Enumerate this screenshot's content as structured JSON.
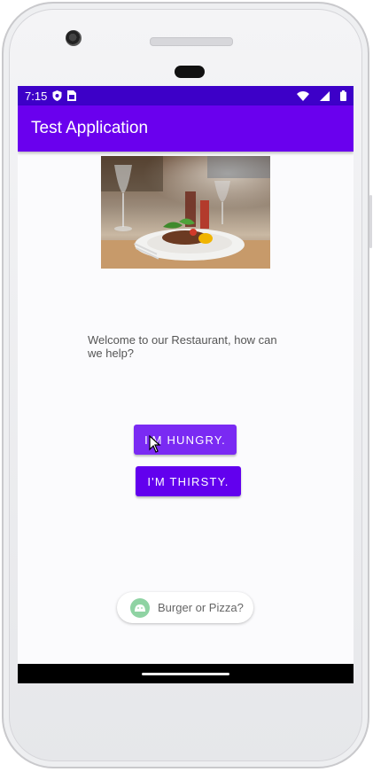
{
  "status_bar": {
    "time": "7:15",
    "left_icons": [
      "shield-icon",
      "sim-card-icon"
    ],
    "right_icons": [
      "wifi-icon",
      "cell-signal-icon",
      "battery-icon"
    ]
  },
  "app_bar": {
    "title": "Test Application"
  },
  "hero_image": {
    "subject": "restaurant-plate-image"
  },
  "welcome_text": "Welcome to our Restaurant, how can we help?",
  "buttons": {
    "hungry": "I'M HUNGRY.",
    "thirsty": "I'M THIRSTY."
  },
  "suggestion_chip": {
    "label": "Burger or Pizza?"
  },
  "colors": {
    "status_bar": "#3d00c8",
    "app_bar": "#6a00ee",
    "button": "#6200ee",
    "chip_icon": "#8fd3a3"
  }
}
